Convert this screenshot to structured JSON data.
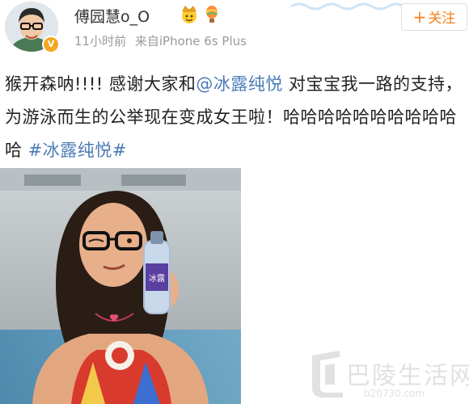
{
  "user": {
    "name": "傅园慧o_O",
    "verified_badge": "V",
    "emojis": [
      "crown-emoji",
      "balloon-emoji"
    ]
  },
  "meta": {
    "time": "11小时前",
    "source": "来自iPhone 6s Plus"
  },
  "follow_button": {
    "plus": "+",
    "label": "关注"
  },
  "post": {
    "text1": "猴开森呐!!!! 感谢大家和",
    "mention": "@冰露纯悦",
    "text2": " 对宝宝我一路的支持，为游泳而生的公举现在变成女王啦！哈哈哈哈哈哈哈哈哈哈哈 ",
    "hashtag": "#冰露纯悦#"
  },
  "photo": {
    "bottle_label": "冰露"
  },
  "watermark": {
    "text": "巴陵生活网",
    "url": "b20730.com"
  },
  "colors": {
    "accent_orange": "#f77e1a",
    "link_blue": "#4a7bb7",
    "verified_gold": "#f5a623"
  }
}
